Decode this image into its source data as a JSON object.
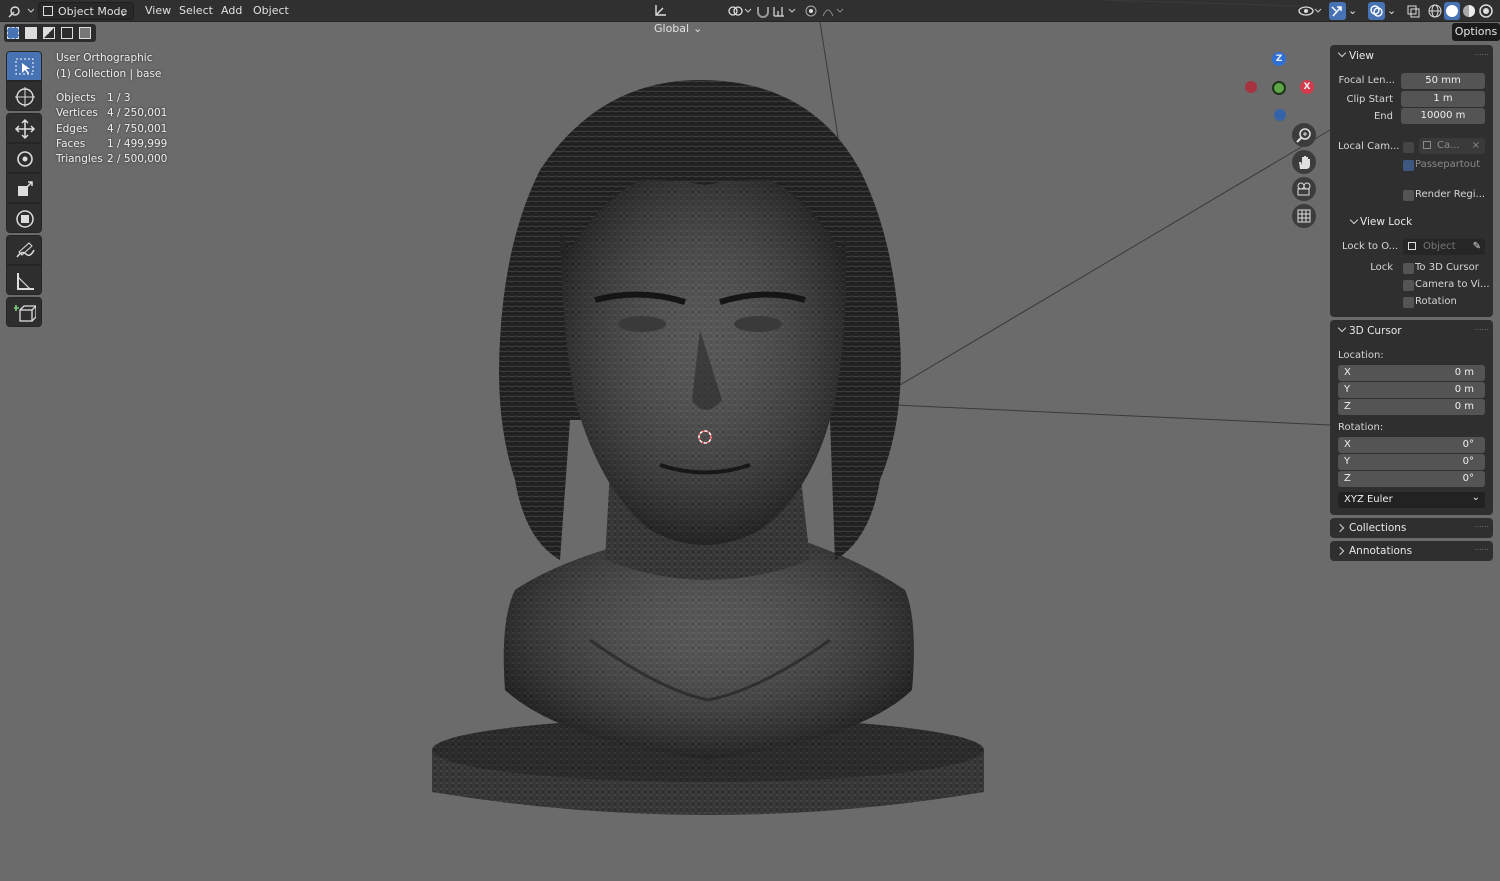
{
  "header": {
    "mode_label": "Object Mode",
    "menus": [
      "View",
      "Select",
      "Add",
      "Object"
    ],
    "orientation_label": "Global"
  },
  "tooltip": {
    "options_label": "Options"
  },
  "overlay": {
    "view_name": "User Orthographic",
    "collection": "(1) Collection | base",
    "stats": [
      {
        "label": "Objects",
        "value": "1 / 3"
      },
      {
        "label": "Vertices",
        "value": "4 / 250,001"
      },
      {
        "label": "Edges",
        "value": "4 / 750,001"
      },
      {
        "label": "Faces",
        "value": "1 / 499,999"
      },
      {
        "label": "Triangles",
        "value": "2 / 500,000"
      }
    ]
  },
  "gizmo": {
    "z": "Z",
    "x": "X"
  },
  "sidebar": {
    "view": {
      "title": "View",
      "focal_label": "Focal Len...",
      "focal_value": "50 mm",
      "clip_start_label": "Clip Start",
      "clip_start_value": "1 m",
      "end_label": "End",
      "end_value": "10000 m",
      "local_cam_label": "Local Cam...",
      "local_cam_value": "Ca...",
      "passepartout_label": "Passepartout",
      "render_region_label": "Render Regi...",
      "view_lock_title": "View Lock",
      "lock_to_label": "Lock to O...",
      "lock_to_placeholder": "Object",
      "lock_label": "Lock",
      "to_cursor_label": "To 3D Cursor",
      "camera_to_view_label": "Camera to Vi...",
      "rotation_label": "Rotation"
    },
    "cursor": {
      "title": "3D Cursor",
      "location_label": "Location:",
      "location": [
        {
          "axis": "X",
          "value": "0 m"
        },
        {
          "axis": "Y",
          "value": "0 m"
        },
        {
          "axis": "Z",
          "value": "0 m"
        }
      ],
      "rotation_label": "Rotation:",
      "rotation": [
        {
          "axis": "X",
          "value": "0°"
        },
        {
          "axis": "Y",
          "value": "0°"
        },
        {
          "axis": "Z",
          "value": "0°"
        }
      ],
      "rotation_mode": "XYZ Euler"
    },
    "collections_title": "Collections",
    "annotations_title": "Annotations"
  }
}
